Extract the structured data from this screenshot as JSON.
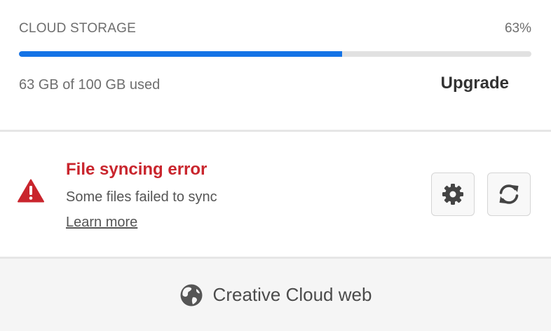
{
  "storage": {
    "title": "CLOUD STORAGE",
    "percent_label": "63%",
    "used_fraction": 0.63,
    "usage_text": "63 GB of 100 GB used",
    "upgrade_label": "Upgrade",
    "accent_color": "#1473e6"
  },
  "error": {
    "icon": "warning-triangle-icon",
    "title": "File syncing error",
    "description": "Some files failed to sync",
    "learn_more_label": "Learn more",
    "color": "#c9252d",
    "actions": [
      {
        "icon": "gear-icon"
      },
      {
        "icon": "sync-icon"
      }
    ]
  },
  "footer": {
    "icon": "globe-icon",
    "label": "Creative Cloud web"
  }
}
